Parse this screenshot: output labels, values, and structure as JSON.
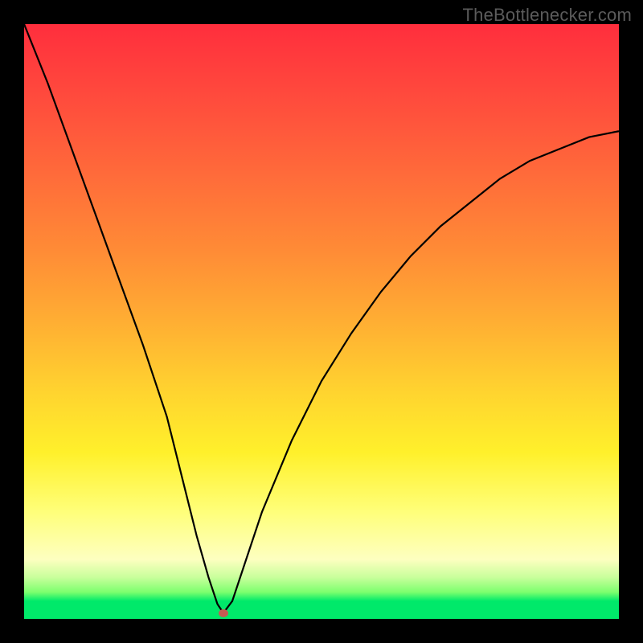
{
  "watermark": "TheBottlenecker.com",
  "chart_data": {
    "type": "line",
    "title": "",
    "xlabel": "",
    "ylabel": "",
    "xlim": [
      0,
      100
    ],
    "ylim": [
      0,
      100
    ],
    "axes_visible": false,
    "grid": false,
    "background_gradient": {
      "direction": "vertical",
      "stops": [
        {
          "pos": 0,
          "color": "#ff2e3d"
        },
        {
          "pos": 25,
          "color": "#ff6a3a"
        },
        {
          "pos": 50,
          "color": "#ffae33"
        },
        {
          "pos": 72,
          "color": "#fff02b"
        },
        {
          "pos": 90,
          "color": "#fdffc0"
        },
        {
          "pos": 97,
          "color": "#00e96a"
        },
        {
          "pos": 100,
          "color": "#00e96a"
        }
      ]
    },
    "series": [
      {
        "name": "bottleneck-curve",
        "color": "#000000",
        "x": [
          0,
          4,
          8,
          12,
          16,
          20,
          24,
          27,
          29,
          31,
          32.5,
          33.5,
          35,
          37,
          40,
          45,
          50,
          55,
          60,
          65,
          70,
          75,
          80,
          85,
          90,
          95,
          100
        ],
        "y": [
          100,
          90,
          79,
          68,
          57,
          46,
          34,
          22,
          14,
          7,
          2.5,
          1.0,
          3,
          9,
          18,
          30,
          40,
          48,
          55,
          61,
          66,
          70,
          74,
          77,
          79,
          81,
          82
        ]
      }
    ],
    "marker": {
      "name": "optimal-point",
      "x": 33.5,
      "y": 1.0,
      "color": "#c65b53"
    }
  }
}
